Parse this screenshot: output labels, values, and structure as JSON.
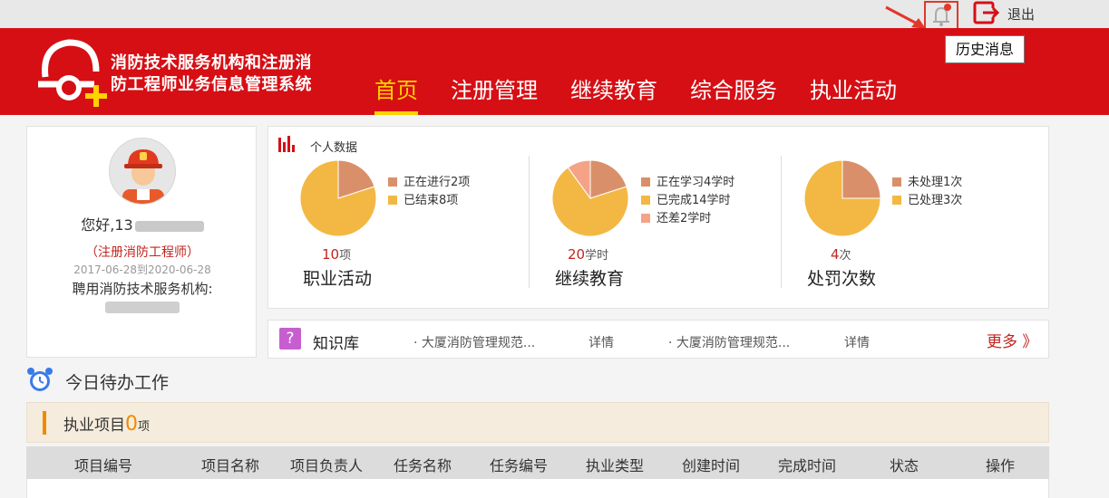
{
  "topbar": {
    "logout_label": "退出",
    "tooltip": "历史消息"
  },
  "header": {
    "system_title_line1": "消防技术服务机构和注册消",
    "system_title_line2": "防工程师业务信息管理系统",
    "nav": [
      "首页",
      "注册管理",
      "继续教育",
      "综合服务",
      "执业活动"
    ],
    "active_nav": "首页"
  },
  "profile": {
    "greeting": "您好,13",
    "role": "（注册消防工程师）",
    "valid_dates": "2017-06-28到2020-06-28",
    "employer_label": "聘用消防技术服务机构:"
  },
  "stats": {
    "title": "个人数据",
    "colors": {
      "salmon": "#d9906a",
      "gold": "#f3b843",
      "pink": "#f4a387"
    },
    "groups": [
      {
        "total": "10",
        "unit": "项",
        "label": "职业活动",
        "legend": [
          "正在进行2项",
          "已结束8项"
        ],
        "slices": [
          2,
          8
        ]
      },
      {
        "total": "20",
        "unit": "学时",
        "label": "继续教育",
        "legend": [
          "正在学习4学时",
          "已完成14学时",
          "还差2学时"
        ],
        "slices": [
          4,
          14,
          2
        ]
      },
      {
        "total": "4",
        "unit": "次",
        "label": "处罚次数",
        "legend": [
          "未处理1次",
          "已处理3次"
        ],
        "slices": [
          1,
          3
        ]
      }
    ]
  },
  "knowledge": {
    "title": "知识库",
    "items": [
      "· 大厦消防管理规范...",
      "· 大厦消防管理规范..."
    ],
    "detail_label": "详情",
    "more_label": "更多 》"
  },
  "todo": {
    "title": "今日待办工作",
    "project_title": "执业项目",
    "project_count": "0",
    "project_unit": "项",
    "columns": [
      "项目编号",
      "项目名称",
      "项目负责人",
      "任务名称",
      "任务编号",
      "执业类型",
      "创建时间",
      "完成时间",
      "状态",
      "操作"
    ]
  }
}
